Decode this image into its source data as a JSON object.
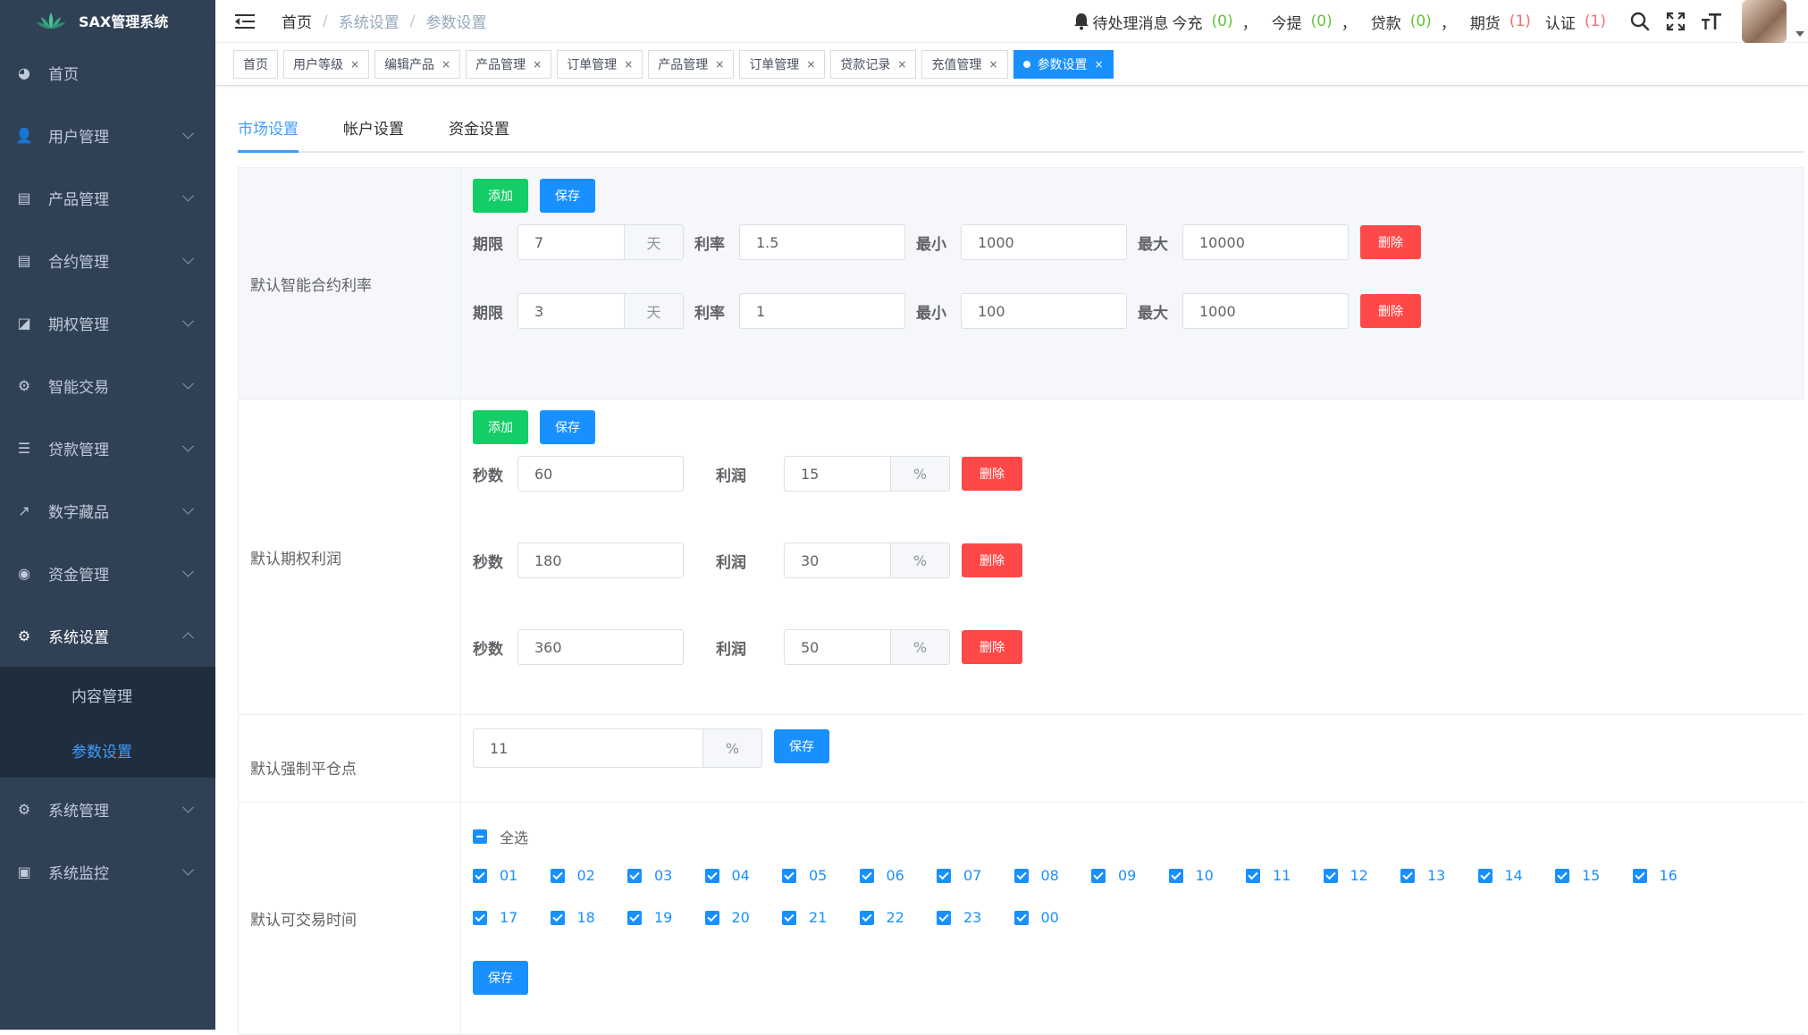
{
  "app": {
    "title": "SAX管理系统"
  },
  "sidebar": {
    "items": [
      {
        "label": "首页",
        "icon": "dashboard-icon"
      },
      {
        "label": "用户管理",
        "icon": "user-icon"
      },
      {
        "label": "产品管理",
        "icon": "document-icon"
      },
      {
        "label": "合约管理",
        "icon": "document-icon"
      },
      {
        "label": "期权管理",
        "icon": "chart-icon"
      },
      {
        "label": "智能交易",
        "icon": "gear-icon"
      },
      {
        "label": "贷款管理",
        "icon": "stack-icon"
      },
      {
        "label": "数字藏品",
        "icon": "trend-icon"
      },
      {
        "label": "资金管理",
        "icon": "money-icon"
      },
      {
        "label": "系统设置",
        "icon": "gear-icon"
      },
      {
        "label": "系统管理",
        "icon": "gear-icon"
      },
      {
        "label": "系统监控",
        "icon": "monitor-icon"
      }
    ],
    "submenu": [
      {
        "label": "内容管理"
      },
      {
        "label": "参数设置"
      }
    ]
  },
  "breadcrumb": [
    "首页",
    "系统设置",
    "参数设置"
  ],
  "header": {
    "notice_label": "待处理消息",
    "items": [
      {
        "label": "今充",
        "count": "(0)",
        "color": "#67c23a"
      },
      {
        "label": "今提",
        "count": "(0)",
        "color": "#67c23a"
      },
      {
        "label": "贷款",
        "count": "(0)",
        "color": "#67c23a"
      },
      {
        "label": "期货",
        "count": "(1)",
        "color": "#f56c6c"
      },
      {
        "label": "认证",
        "count": "(1)",
        "color": "#f56c6c"
      }
    ],
    "separator": "，"
  },
  "tags": [
    {
      "label": "首页",
      "closable": false
    },
    {
      "label": "用户等级",
      "closable": true
    },
    {
      "label": "编辑产品",
      "closable": true
    },
    {
      "label": "产品管理",
      "closable": true
    },
    {
      "label": "订单管理",
      "closable": true
    },
    {
      "label": "产品管理",
      "closable": true
    },
    {
      "label": "订单管理",
      "closable": true
    },
    {
      "label": "贷款记录",
      "closable": true
    },
    {
      "label": "充值管理",
      "closable": true
    },
    {
      "label": "参数设置",
      "closable": true,
      "active": true
    }
  ],
  "tabs": [
    "市场设置",
    "帐户设置",
    "资金设置"
  ],
  "buttons": {
    "add": "添加",
    "save": "保存",
    "delete": "删除"
  },
  "smart_contract": {
    "label": "默认智能合约利率",
    "f_period": "期限",
    "f_rate": "利率",
    "f_min": "最小",
    "f_max": "最大",
    "unit": "天",
    "rows": [
      {
        "period": "7",
        "rate": "1.5",
        "min": "1000",
        "max": "10000"
      },
      {
        "period": "3",
        "rate": "1",
        "min": "100",
        "max": "1000"
      }
    ]
  },
  "option_profit": {
    "label": "默认期权利润",
    "f_seconds": "秒数",
    "f_profit": "利润",
    "unit": "%",
    "rows": [
      {
        "seconds": "60",
        "profit": "15"
      },
      {
        "seconds": "180",
        "profit": "30"
      },
      {
        "seconds": "360",
        "profit": "50"
      }
    ]
  },
  "liquidation": {
    "label": "默认强制平仓点",
    "value": "11",
    "unit": "%"
  },
  "trade_time": {
    "label": "默认可交易时间",
    "select_all": "全选",
    "hours": [
      "01",
      "02",
      "03",
      "04",
      "05",
      "06",
      "07",
      "08",
      "09",
      "10",
      "11",
      "12",
      "13",
      "14",
      "15",
      "16",
      "17",
      "18",
      "19",
      "20",
      "21",
      "22",
      "23",
      "00"
    ]
  }
}
